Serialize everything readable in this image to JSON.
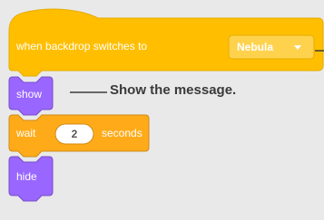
{
  "blocks": {
    "hat": {
      "label": "when backdrop switches to",
      "dropdown_value": "Nebula"
    },
    "show": {
      "label": "show"
    },
    "wait": {
      "label_before": "wait",
      "value": "2",
      "label_after": "seconds"
    },
    "hide": {
      "label": "hide"
    }
  },
  "annotation": {
    "text": "Show the message."
  },
  "colors": {
    "events": "#ffbf00",
    "events_dark": "#e6ac00",
    "events_dropdown": "#ffd24d",
    "control": "#ffab19",
    "control_dark": "#cf8b17",
    "looks": "#9966ff",
    "looks_dark": "#774dcb",
    "background": "#e9e9e9"
  },
  "icons": {
    "dropdown": "dropdown-caret-icon"
  }
}
